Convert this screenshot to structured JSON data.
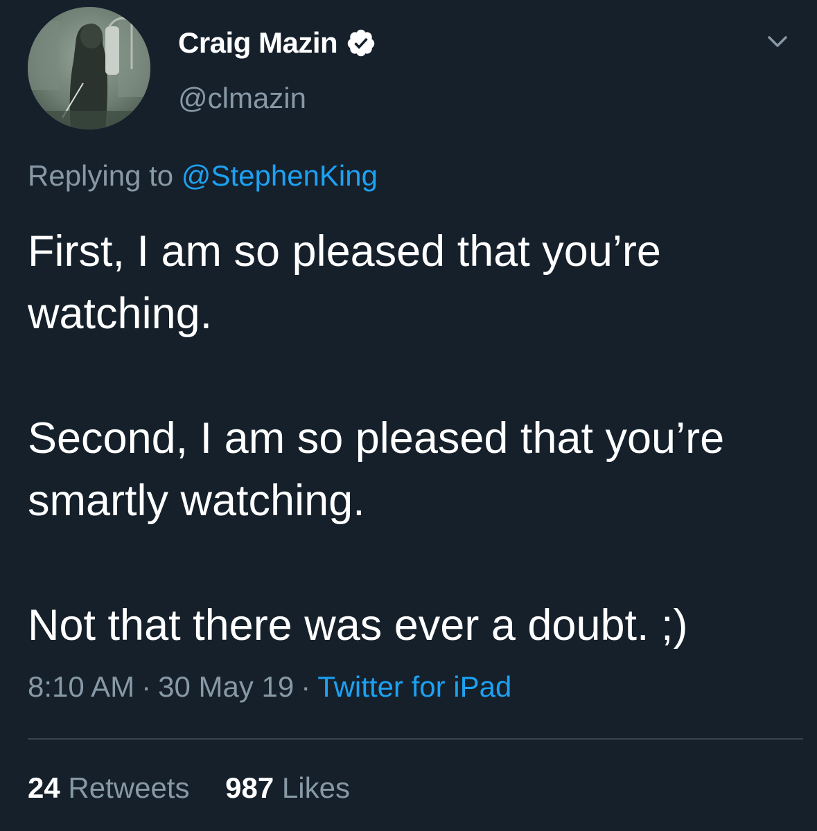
{
  "tweet": {
    "author": {
      "display_name": "Craig Mazin",
      "handle": "@clmazin",
      "verified": true
    },
    "reply_prefix": "Replying to",
    "reply_to": "@StephenKing",
    "paragraphs": [
      "First, I am so pleased that you’re watching.",
      "Second, I am so pleased that you’re smartly watching.",
      "Not that there was ever a doubt. ;)"
    ],
    "time": "8:10 AM",
    "date": "30 May 19",
    "source": "Twitter for iPad",
    "separator": "·",
    "retweets": {
      "count": "24",
      "label": "Retweets"
    },
    "likes": {
      "count": "987",
      "label": "Likes"
    }
  },
  "icons": {
    "verified": "verified-badge-icon",
    "menu": "chevron-down-icon"
  },
  "colors": {
    "background": "#15202b",
    "text_primary": "#ffffff",
    "text_secondary": "#8899a6",
    "link": "#1da1f2",
    "divider": "#38444d"
  }
}
